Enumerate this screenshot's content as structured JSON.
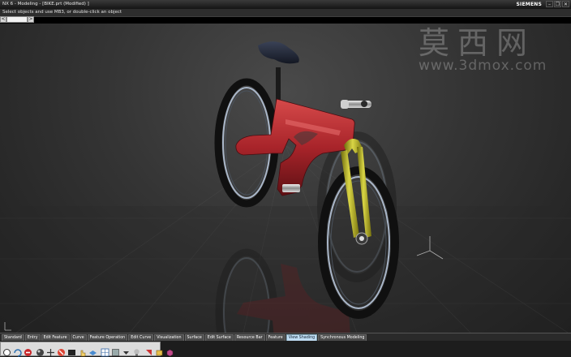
{
  "window": {
    "title": "NX 6 - Modeling - [BIKE.prt (Modified) ]",
    "brand": "SIEMENS",
    "controls": [
      "–",
      "❐",
      "✕"
    ]
  },
  "cue_line": "Select objects and use MB3, or double-click an object",
  "nav": {
    "back": "<",
    "forward": ">"
  },
  "watermark": {
    "chinese": "莫西网",
    "url": "www.3dmox.com"
  },
  "resource_tabs": [
    "Standard",
    "Entry",
    "Edit Feature",
    "Curve",
    "Feature Operation",
    "Edit Curve",
    "Visualization",
    "Surface",
    "Edit Surface",
    "Resource Bar",
    "Feature",
    "View Shading",
    "Synchronous Modeling"
  ],
  "active_tab": "View Shading",
  "toolbar_icons": [
    "select-icon",
    "refresh-icon",
    "stop-icon",
    "sphere-icon",
    "move-icon",
    "cancel-icon",
    "display-icon",
    "hand-pointer-icon",
    "layer-icon",
    "grid-icon",
    "shade-icon",
    "dropdown-icon",
    "light-icon",
    "render-icon",
    "box-icon",
    "cube-icon"
  ],
  "colors": {
    "frame": "#b4262a",
    "fork": "#b7b41c",
    "tire": "#121212",
    "rim": "#a9b6c8",
    "seat": "#1e2433",
    "active_tab": "#bfdcf2"
  }
}
